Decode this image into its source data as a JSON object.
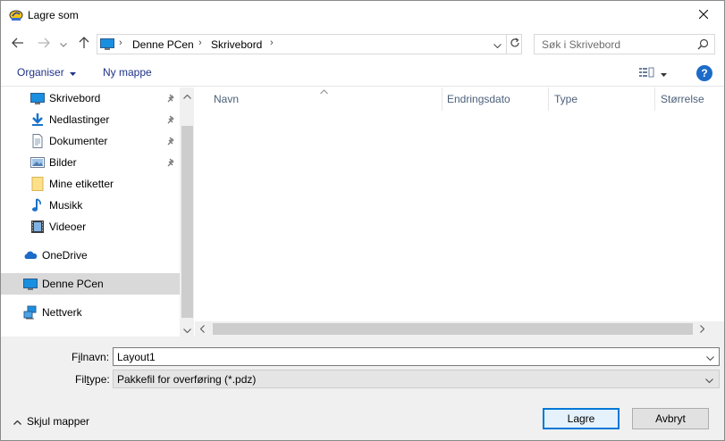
{
  "window": {
    "title": "Lagre som",
    "close_icon": "close-icon"
  },
  "address": {
    "segments": [
      "Denne PCen",
      "Skrivebord"
    ],
    "search_placeholder": "Søk i Skrivebord"
  },
  "toolbar": {
    "organise_label": "Organiser",
    "new_folder_label": "Ny mappe",
    "help_label": "?"
  },
  "nav": {
    "items": [
      {
        "label": "Skrivebord",
        "icon": "desktop-icon",
        "pinned": true
      },
      {
        "label": "Nedlastinger",
        "icon": "download-icon",
        "pinned": true
      },
      {
        "label": "Dokumenter",
        "icon": "documents-icon",
        "pinned": true
      },
      {
        "label": "Bilder",
        "icon": "pictures-icon",
        "pinned": true
      },
      {
        "label": "Mine etiketter",
        "icon": "folder-icon",
        "pinned": false
      },
      {
        "label": "Musikk",
        "icon": "music-icon",
        "pinned": false
      },
      {
        "label": "Videoer",
        "icon": "video-icon",
        "pinned": false
      },
      {
        "label": "OneDrive",
        "icon": "onedrive-icon",
        "pinned": false
      },
      {
        "label": "Denne PCen",
        "icon": "computer-icon",
        "pinned": false,
        "selected": true
      },
      {
        "label": "Nettverk",
        "icon": "network-icon",
        "pinned": false
      }
    ]
  },
  "filelist": {
    "columns": [
      "Navn",
      "Endringsdato",
      "Type",
      "Størrelse"
    ]
  },
  "bottom": {
    "filename_label_pre": "F",
    "filename_label_u": "i",
    "filename_label_post": "lnavn:",
    "filename_value": "Layout1",
    "filetype_label_pre": "Fil",
    "filetype_label_u": "t",
    "filetype_label_post": "ype:",
    "filetype_value": "Pakkefil for overføring (*.pdz)",
    "hide_folders_label": "Skjul mapper",
    "save_label": "Lagre",
    "cancel_label": "Avbryt"
  },
  "colors": {
    "accent": "#0078d7",
    "link": "#1e3287",
    "selected_row": "#d9d9d9",
    "panel": "#f0f0f0"
  }
}
